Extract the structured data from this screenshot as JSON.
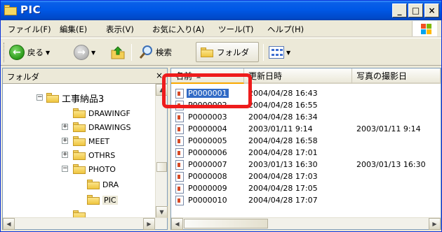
{
  "window": {
    "title": "PIC"
  },
  "menu": {
    "items": [
      "ファイル(F)",
      "編集(E)",
      "表示(V)",
      "お気に入り(A)",
      "ツール(T)",
      "ヘルプ(H)"
    ]
  },
  "toolbar": {
    "back_label": "戻る",
    "search_label": "検索",
    "folders_label": "フォルダ"
  },
  "folders_pane": {
    "title": "フォルダ",
    "close": "×",
    "tree": [
      {
        "label": "工事納品3",
        "expander": "−"
      },
      {
        "label": "DRAWINGF",
        "expander": ""
      },
      {
        "label": "DRAWINGS",
        "expander": "+"
      },
      {
        "label": "MEET",
        "expander": "+"
      },
      {
        "label": "OTHRS",
        "expander": "+"
      },
      {
        "label": "PHOTO",
        "expander": "−"
      },
      {
        "label": "DRA",
        "expander": ""
      },
      {
        "label": "PIC",
        "expander": ""
      }
    ]
  },
  "file_list": {
    "columns": [
      "名前",
      "更新日時",
      "写真の撮影日"
    ],
    "rows": [
      {
        "name": "P0000001",
        "modified": "2004/04/28 16:43",
        "taken": ""
      },
      {
        "name": "P0000002",
        "modified": "2004/04/28 16:55",
        "taken": ""
      },
      {
        "name": "P0000003",
        "modified": "2004/04/28 16:34",
        "taken": ""
      },
      {
        "name": "P0000004",
        "modified": "2003/01/11 9:14",
        "taken": "2003/01/11 9:14"
      },
      {
        "name": "P0000005",
        "modified": "2004/04/28 16:58",
        "taken": ""
      },
      {
        "name": "P0000006",
        "modified": "2004/04/28 17:01",
        "taken": ""
      },
      {
        "name": "P0000007",
        "modified": "2003/01/13 16:30",
        "taken": "2003/01/13 16:30"
      },
      {
        "name": "P0000008",
        "modified": "2004/04/28 17:03",
        "taken": ""
      },
      {
        "name": "P0000009",
        "modified": "2004/04/28 17:05",
        "taken": ""
      },
      {
        "name": "P0000010",
        "modified": "2004/04/28 17:07",
        "taken": ""
      }
    ]
  },
  "colors": {
    "highlight": "#ee1c1c",
    "selection": "#316ac5",
    "titlebar": "#0058e6"
  }
}
